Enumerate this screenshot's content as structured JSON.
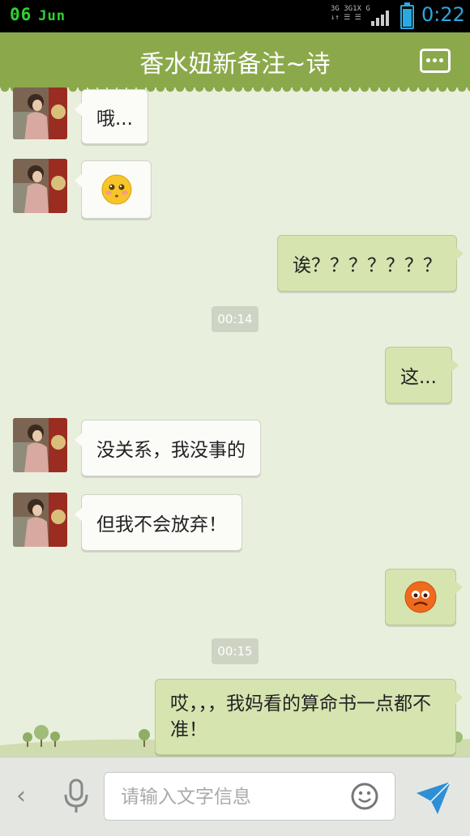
{
  "status": {
    "date": "06",
    "month": "Jun",
    "network": [
      "3G 3G1X G",
      "↓↑ ☰ ☰"
    ],
    "time": "0:22"
  },
  "header": {
    "title": "香水妞新备注~诗"
  },
  "messages": [
    {
      "side": "in",
      "text": "哦..."
    },
    {
      "side": "in",
      "emoji": "blushing-face"
    },
    {
      "side": "out",
      "text": "诶？？？？？？？"
    },
    {
      "time": "00:14"
    },
    {
      "side": "out",
      "text": "这..."
    },
    {
      "side": "in",
      "text": "没关系，我没事的"
    },
    {
      "side": "in",
      "text": "但我不会放弃！"
    },
    {
      "side": "out",
      "emoji": "worried-face"
    },
    {
      "time": "00:15"
    },
    {
      "side": "out",
      "text": "哎，，，我妈看的算命书一点都不准！"
    }
  ],
  "input": {
    "placeholder": "请输入文字信息",
    "value": ""
  },
  "colors": {
    "header": "#8ba94b",
    "chat_bg": "#e9efdd",
    "out_bubble": "#d6e4b0",
    "in_bubble": "#fbfbf8",
    "accent_blue": "#29a9e0"
  }
}
